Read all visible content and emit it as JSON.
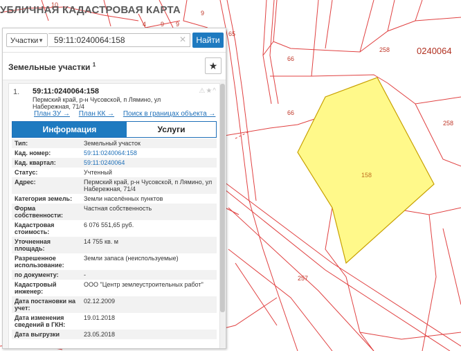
{
  "map": {
    "title": "УБЛИЧНАЯ КАДАСТРОВАЯ КАРТА",
    "labels": {
      "l10": "10",
      "l9a": "9",
      "l4": "4",
      "l9b": "9",
      "l9c": "9",
      "l65": "65",
      "l258a": "258",
      "quarter": "0240064",
      "l66a": "66",
      "l66b": "66",
      "l258b": "258",
      "l158": "158",
      "l257": "257"
    },
    "colors": {
      "boundary": "#e04040",
      "selected_fill": "#fff98a",
      "selected_stroke": "#c8a000"
    }
  },
  "search": {
    "type_label": "Участки",
    "value": "59:11:0240064:158",
    "clear_icon": "✕",
    "find_label": "Найти"
  },
  "panel": {
    "title": "Земельные участки",
    "count": "1",
    "star_icon": "★"
  },
  "result": {
    "index": "1.",
    "cad_number": "59:11:0240064:158",
    "address_short": "Пермский край, р-н Чусовской, п Лямино, ул Набережная, 71/4",
    "links": [
      "План ЗУ →",
      "План КК →",
      "Поиск в границах объекта →"
    ],
    "tabs": {
      "info": "Информация",
      "services": "Услуги"
    }
  },
  "info_rows": [
    {
      "k": "Тип:",
      "v": "Земельный участок"
    },
    {
      "k": "Кад. номер:",
      "v": "59:11:0240064:158",
      "link": true
    },
    {
      "k": "Кад. квартал:",
      "v": "59:11:0240064",
      "link": true
    },
    {
      "k": "Статус:",
      "v": "Учтенный"
    },
    {
      "k": "Адрес:",
      "v": "Пермский край, р-н Чусовской, п Лямино, ул Набережная, 71/4"
    },
    {
      "k": "Категория земель:",
      "v": "Земли населённых пунктов"
    },
    {
      "k": "Форма собственности:",
      "v": "Частная собственность"
    },
    {
      "k": "Кадастровая стоимость:",
      "v": "6 076 551,65 руб."
    },
    {
      "k": "Уточненная площадь:",
      "v": "14 755 кв. м"
    },
    {
      "k": "Разрешенное использование:",
      "v": "Земли запаса (неиспользуемые)"
    },
    {
      "k": "по документу:",
      "v": "-"
    },
    {
      "k": "Кадастровый инженер:",
      "v": "ООО \"Центр землеустроительных работ\""
    },
    {
      "k": "Дата постановки на учет:",
      "v": "02.12.2009"
    },
    {
      "k": "Дата изменения сведений в ГКН:",
      "v": "19.01.2018"
    },
    {
      "k": "Дата выгрузки",
      "v": "23.05.2018"
    }
  ]
}
